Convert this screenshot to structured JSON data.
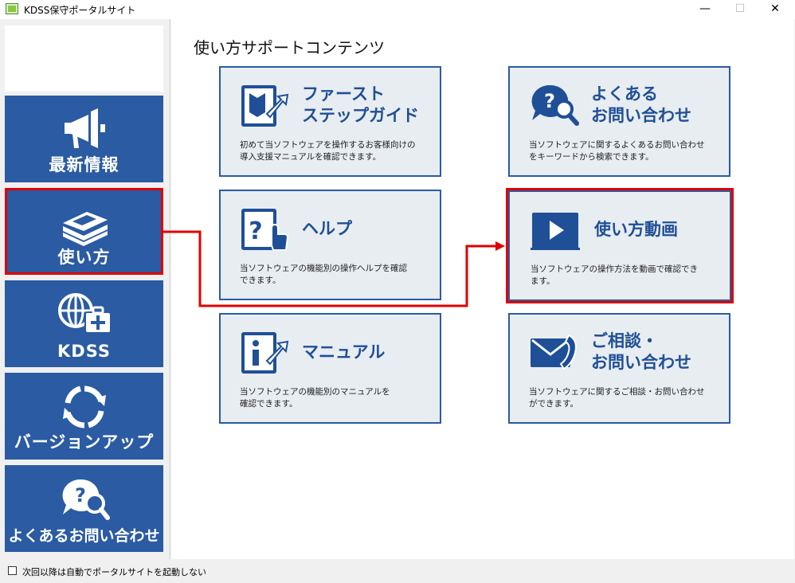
{
  "window": {
    "title": "KDSS保守ポータルサイト",
    "min_glyph": "—",
    "max_glyph": "☐",
    "close_glyph": "✕"
  },
  "sidebar": {
    "items": [
      {
        "label": "最新情報",
        "icon": "megaphone-icon"
      },
      {
        "label": "使い方",
        "icon": "book-stack-icon",
        "selected": true
      },
      {
        "label": "KDSS",
        "icon": "globe-medical-icon"
      },
      {
        "label": "バージョンアップ",
        "icon": "refresh-icon"
      },
      {
        "label": "よくあるお問い合わせ",
        "icon": "faq-search-icon"
      }
    ]
  },
  "main": {
    "title": "使い方サポートコンテンツ",
    "cards": [
      {
        "title_line1": "ファースト",
        "title_line2": "ステップガイド",
        "desc_line1": "初めて当ソフトウェアを操作するお客様向けの",
        "desc_line2": "導入支援マニュアルを確認できます。",
        "icon": "guide-book-icon"
      },
      {
        "title_line1": "よくある",
        "title_line2": "お問い合わせ",
        "desc_line1": "当ソフトウェアに関するよくあるお問い合わせ",
        "desc_line2": "をキーワードから検索できます。",
        "icon": "faq-search-icon"
      },
      {
        "title_line1": "ヘルプ",
        "desc_line1": "当ソフトウェアの機能別の操作ヘルプを確認",
        "desc_line2": "できます。",
        "icon": "help-book-icon"
      },
      {
        "title_line1": "使い方動画",
        "desc_line1": "当ソフトウェアの操作方法を動画で確認でき",
        "desc_line2": "ます。",
        "icon": "video-play-icon",
        "highlighted": true
      },
      {
        "title_line1": "マニュアル",
        "desc_line1": "当ソフトウェアの機能別のマニュアルを",
        "desc_line2": "確認できます。",
        "icon": "info-book-icon"
      },
      {
        "title_line1": "ご相談・",
        "title_line2": "お問い合わせ",
        "desc_line1": "当ソフトウェアに関するご相談・お問い合わせ",
        "desc_line2": "ができます。",
        "icon": "mail-phone-icon"
      }
    ]
  },
  "footer": {
    "checkbox_label": "次回以降は自動でポータルサイトを起動しない",
    "checked": false
  },
  "colors": {
    "brand_blue": "#2a5ba3",
    "highlight_red": "#e00000",
    "card_bg": "#e8edf1"
  }
}
